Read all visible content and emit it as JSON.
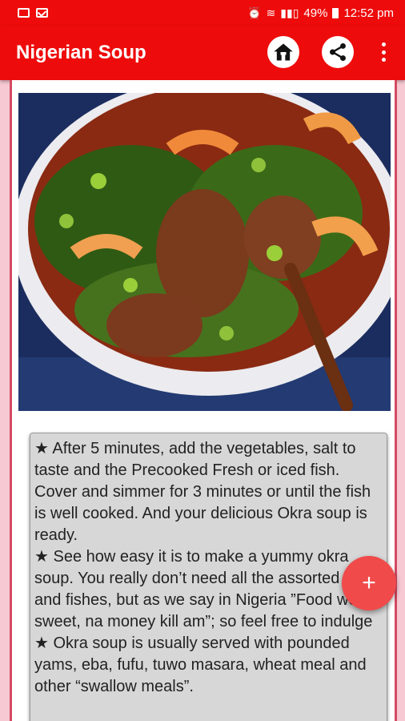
{
  "status_bar": {
    "battery": "49%",
    "time": "12:52 pm"
  },
  "app_bar": {
    "title": "Nigerian Soup",
    "icons": [
      "home-icon",
      "share-icon",
      "more-vertical-icon"
    ]
  },
  "content": {
    "image": "okra soup with shrimp and meat in a white bowl",
    "paragraphs": [
      "After 5 minutes, add the vegetables, salt to taste and the Precooked Fresh or iced fish. Cover and simmer for 3 minutes or until the fish is well cooked. And your delicious Okra soup is ready.",
      "See how easy it is to make a yummy okra soup. You really don’t need all the assorted meat and fishes, but as we say in Nigeria ”Food wey sweet, na money kill am”; so feel free to indulge",
      "Okra soup is usually served with pounded yams, eba, fufu, tuwo masara, wheat meal and other “swallow meals”."
    ],
    "bullet": "★"
  },
  "fab": {
    "label": "+"
  },
  "colors": {
    "primary": "#ee0b0b",
    "fab": "#f04a4a",
    "card": "#d7d7d7",
    "background": "#f7c9d3"
  }
}
